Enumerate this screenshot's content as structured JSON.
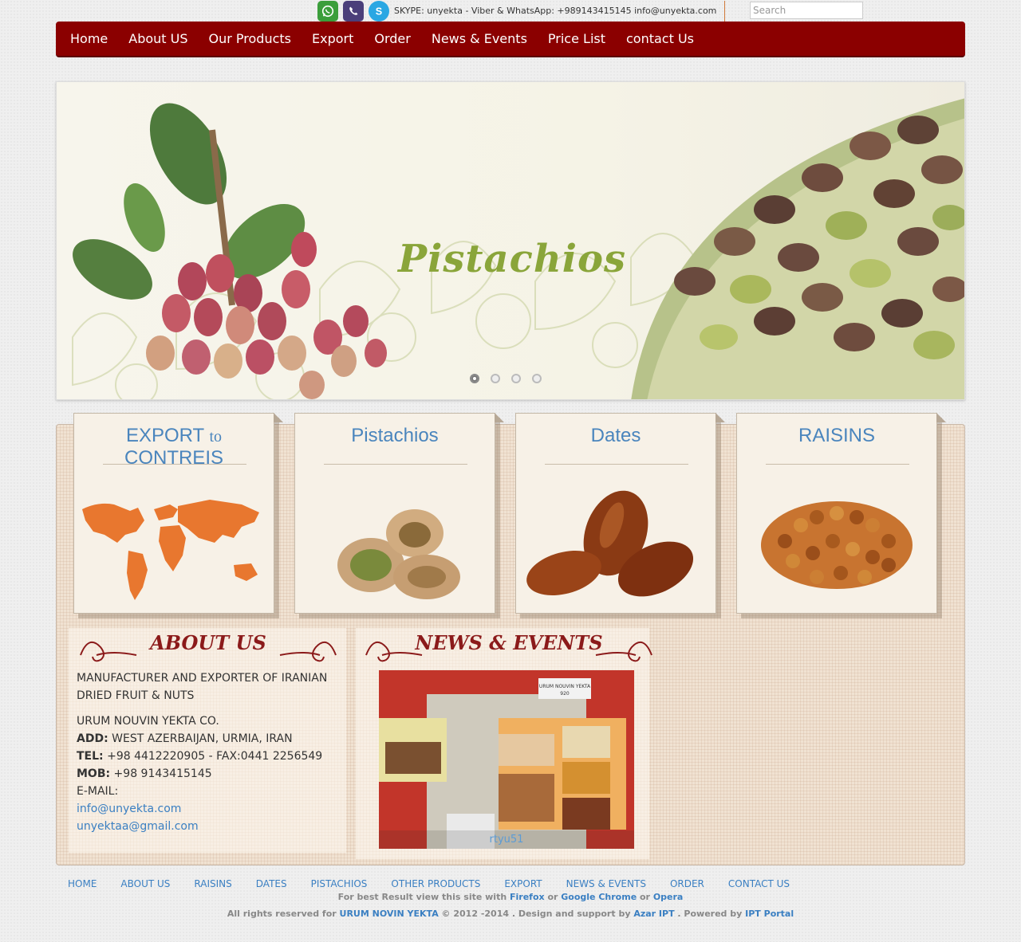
{
  "topbar": {
    "contact": "SKYPE: unyekta - Viber & WhatsApp: +989143415145 info@unyekta.com",
    "search_placeholder": "Search",
    "icons": [
      "whatsapp-icon",
      "viber-icon",
      "skype-icon"
    ]
  },
  "nav": {
    "items": [
      "Home",
      "About US",
      "Our Products",
      "Export",
      "Order",
      "News & Events",
      "Price List",
      "contact Us"
    ]
  },
  "slider": {
    "title": "Pistachios",
    "dot_count": 4,
    "active_dot": 1
  },
  "cards": [
    {
      "title_a": "EXPORT ",
      "title_b": "to",
      "title_c": " CONTREIS"
    },
    {
      "title": "Pistachios"
    },
    {
      "title": "Dates"
    },
    {
      "title": "RAISINS"
    }
  ],
  "about": {
    "heading": "ABOUT US",
    "intro": "MANUFACTURER AND EXPORTER OF IRANIAN DRIED FRUIT & NUTS",
    "company": "URUM NOUVIN YEKTA CO.",
    "add_label": "ADD:",
    "add_value": " WEST AZERBAIJAN, URMIA, IRAN",
    "tel_label": "TEL:",
    "tel_value": " +98 4412220905 - FAX:0441 2256549",
    "mob_label": "MOB:",
    "mob_value": " +98 9143415145",
    "email_label": "E-MAIL:",
    "email_1": "info@unyekta.com",
    "email_2": "unyektaa@gmail.com"
  },
  "news": {
    "heading": "NEWS & EVENTS",
    "booth_sign": "URUM NOUVIN YEKTA",
    "booth_number": "920",
    "caption": "rtyu51"
  },
  "footer": {
    "links": [
      "HOME",
      "ABOUT US",
      "RAISINS",
      "DATES",
      "PISTACHIOS",
      "OTHER PRODUCTS",
      "EXPORT",
      "NEWS & EVENTS",
      "ORDER",
      "CONTACT US"
    ],
    "browser_pre": "For best Result view this site with ",
    "firefox": "Firefox",
    "or1": " or ",
    "chrome": "Google Chrome",
    "or2": " or ",
    "opera": "Opera",
    "rights_pre": "All rights reserved for ",
    "company": "URUM NOVIN YEKTA",
    "rights_mid": " © 2012 -2014   . Design and support by ",
    "designer": "Azar IPT",
    "powered_mid": " . Powered by ",
    "portal": "IPT Portal"
  },
  "colors": {
    "nav_bg": "#8b0000",
    "heading_red": "#8b1a1a",
    "link_blue": "#3a7fc2",
    "card_title_blue": "#4a85bd",
    "pistachio_green": "#8aa53a"
  }
}
